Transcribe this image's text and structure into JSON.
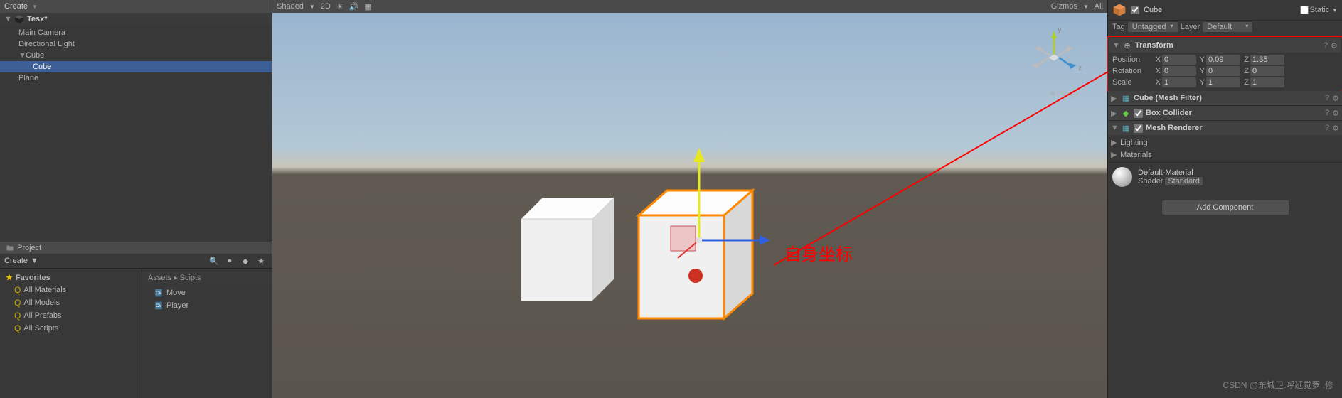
{
  "hierarchy": {
    "create_label": "Create",
    "scene_name": "Tesx*",
    "items": [
      {
        "label": "Main Camera",
        "indent": 1
      },
      {
        "label": "Directional Light",
        "indent": 1
      },
      {
        "label": "Cube",
        "indent": 1,
        "fold": "▼"
      },
      {
        "label": "Cube",
        "indent": 2,
        "selected": true
      },
      {
        "label": "Plane",
        "indent": 1
      }
    ]
  },
  "project": {
    "tab_label": "Project",
    "create_label": "Create",
    "favorites_label": "Favorites",
    "fav_items": [
      "All Materials",
      "All Models",
      "All Prefabs",
      "All Scripts"
    ],
    "breadcrumb": "Assets ▸ Scipts",
    "assets": [
      "Move",
      "Player"
    ]
  },
  "scene_toolbar": {
    "shaded": "Shaded",
    "mode": "2D",
    "gizmos": "Gizmos",
    "all": "All"
  },
  "scene_view": {
    "axis_y": "y",
    "axis_z": "z",
    "persp": "Persp"
  },
  "annotation_text": "自身坐标",
  "inspector": {
    "name": "Cube",
    "static_label": "Static",
    "tag_label": "Tag",
    "tag_value": "Untagged",
    "layer_label": "Layer",
    "layer_value": "Default",
    "transform": {
      "title": "Transform",
      "position": {
        "label": "Position",
        "x": "0",
        "y": "0.09",
        "z": "1.35"
      },
      "rotation": {
        "label": "Rotation",
        "x": "0",
        "y": "0",
        "z": "0"
      },
      "scale": {
        "label": "Scale",
        "x": "1",
        "y": "1",
        "z": "1"
      }
    },
    "components": {
      "mesh_filter": "Cube (Mesh Filter)",
      "box_collider": "Box Collider",
      "mesh_renderer": "Mesh Renderer",
      "lighting": "Lighting",
      "materials": "Materials"
    },
    "material": {
      "name": "Default-Material",
      "shader_label": "Shader",
      "shader_value": "Standard"
    },
    "add_component": "Add Component"
  },
  "axis_labels": {
    "x": "X",
    "y": "Y",
    "z": "Z"
  },
  "watermark": "CSDN @东城卫.呼延觉罗 .修"
}
